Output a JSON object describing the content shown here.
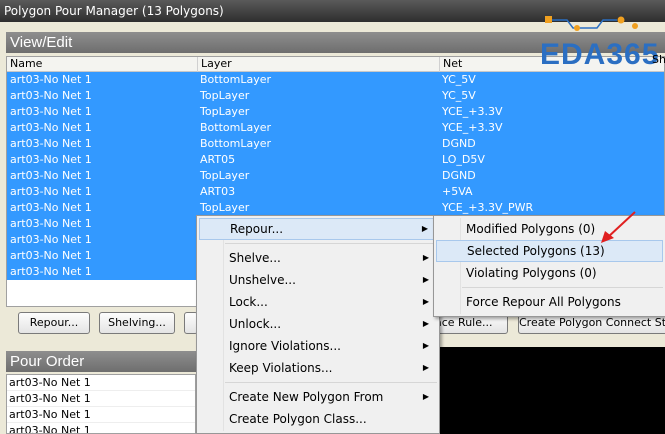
{
  "window": {
    "title": "Polygon Pour Manager (13 Polygons)"
  },
  "view_edit": {
    "header": "View/Edit",
    "columns": {
      "name": "Name",
      "layer": "Layer",
      "net": "Net",
      "sh": "Sh"
    },
    "rows": [
      {
        "name": "art03-No Net 1",
        "layer": "BottomLayer",
        "net": "YC_5V",
        "selected": true
      },
      {
        "name": "art03-No Net 1",
        "layer": "TopLayer",
        "net": "YC_5V",
        "selected": true
      },
      {
        "name": "art03-No Net 1",
        "layer": "TopLayer",
        "net": "YCE_+3.3V",
        "selected": true
      },
      {
        "name": "art03-No Net 1",
        "layer": "BottomLayer",
        "net": "YCE_+3.3V",
        "selected": true
      },
      {
        "name": "art03-No Net 1",
        "layer": "BottomLayer",
        "net": "DGND",
        "selected": true
      },
      {
        "name": "art03-No Net 1",
        "layer": "ART05",
        "net": "LO_D5V",
        "selected": true
      },
      {
        "name": "art03-No Net 1",
        "layer": "TopLayer",
        "net": "DGND",
        "selected": true
      },
      {
        "name": "art03-No Net 1",
        "layer": "ART03",
        "net": "+5VA",
        "selected": true
      },
      {
        "name": "art03-No Net 1",
        "layer": "TopLayer",
        "net": "YCE_+3.3V_PWR",
        "selected": true
      },
      {
        "name": "art03-No Net 1",
        "layer": "",
        "net": "",
        "selected": true
      },
      {
        "name": "art03-No Net 1",
        "layer": "",
        "net": "",
        "selected": true
      },
      {
        "name": "art03-No Net 1",
        "layer": "",
        "net": "",
        "selected": true
      },
      {
        "name": "art03-No Net 1",
        "layer": "",
        "net": "",
        "selected": true
      }
    ]
  },
  "buttons": {
    "repour": "Repour...",
    "shelving": "Shelving...",
    "face_rule": "ace Rule...",
    "create_connect": "Create Polygon Connect Sty"
  },
  "pour_order": {
    "header": "Pour Order",
    "items": [
      "art03-No Net 1",
      "art03-No Net 1",
      "art03-No Net 1",
      "art03-No Net 1"
    ]
  },
  "context_menu": {
    "items": [
      {
        "label": "Repour...",
        "submenu": true
      },
      {
        "label": "Shelve...",
        "submenu": true
      },
      {
        "label": "Unshelve...",
        "submenu": true
      },
      {
        "label": "Lock...",
        "submenu": true
      },
      {
        "label": "Unlock...",
        "submenu": true
      },
      {
        "label": "Ignore Violations...",
        "submenu": true
      },
      {
        "label": "Keep Violations...",
        "submenu": true
      },
      {
        "label": "Create New Polygon From",
        "submenu": true
      },
      {
        "label": "Create Polygon Class...",
        "submenu": false
      }
    ]
  },
  "repour_submenu": {
    "items": [
      {
        "label": "Modified Polygons  (0)"
      },
      {
        "label": "Selected Polygons (13)"
      },
      {
        "label": "Violating Polygons (0)"
      },
      {
        "label": "Force Repour All Polygons"
      }
    ]
  },
  "logo": {
    "text": "EDA365",
    "accent": "#2b6fc2",
    "dot_color": "#f0a020"
  },
  "colors": {
    "selection": "#3399ff",
    "arrow": "#e02020"
  }
}
